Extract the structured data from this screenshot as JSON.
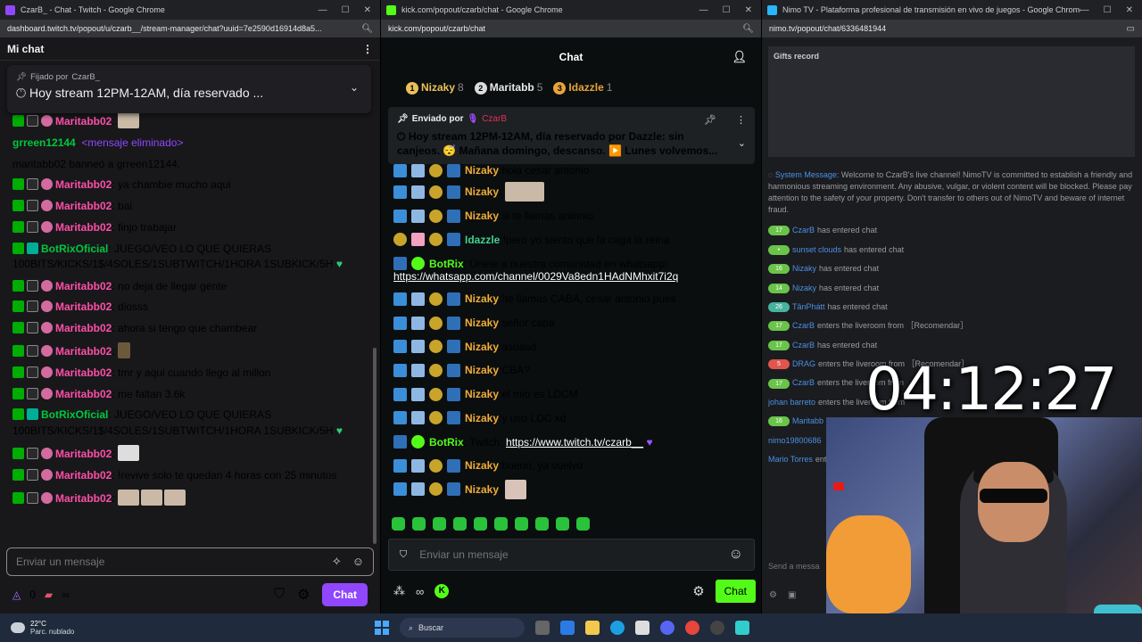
{
  "twitch": {
    "window_title": "CzarB_ - Chat - Twitch - Google Chrome",
    "url": "dashboard.twitch.tv/popout/u/czarb__/stream-manager/chat?uuid=7e2590d16914d8a5...",
    "header": "Mi chat",
    "pinned_by_label": "Fijado por",
    "pinned_by_name": "CzarB_",
    "pinned_message": "Hoy stream 12PM-12AM, día reservado ...",
    "messages": [
      {
        "name": "Maritabb02",
        "text": ""
      },
      {
        "name": "grreen12144",
        "text": "<mensaje eliminado>"
      },
      {
        "name": "",
        "text": "maritabb02 banneó a grreen12144."
      },
      {
        "name": "Maritabb02",
        "text": "ya chambie mucho aqui"
      },
      {
        "name": "Maritabb02",
        "text": "bai"
      },
      {
        "name": "Maritabb02",
        "text": "finjo trabajar"
      },
      {
        "name": "BotRixOficial",
        "text": "JUEGO/VEO LO QUE QUIERAS 100BITS/KICKS/1$/4SOLES/1SUBTWITCH/1HORA 1SUBKICK/5H"
      },
      {
        "name": "Maritabb02",
        "text": "no deja de llegar gente"
      },
      {
        "name": "Maritabb02",
        "text": "diosss"
      },
      {
        "name": "Maritabb02",
        "text": "ahora si tengo que chambear"
      },
      {
        "name": "Maritabb02",
        "text": ""
      },
      {
        "name": "Maritabb02",
        "text": "tmr y aqui cuando llego al millon"
      },
      {
        "name": "Maritabb02",
        "text": "me faltan 3.6k"
      },
      {
        "name": "BotRixOficial",
        "text": "JUEGO/VEO LO QUE QUIERAS 100BITS/KICKS/1$/4SOLES/1SUBTWITCH/1HORA 1SUBKICK/5H"
      },
      {
        "name": "Maritabb02",
        "text": ""
      },
      {
        "name": "Maritabb02",
        "text": "!revive solo te quedan 4 horas con 25 minutos"
      },
      {
        "name": "Maritabb02",
        "text": ""
      }
    ],
    "input_placeholder": "Enviar un mensaje",
    "points": "0",
    "chat_button": "Chat"
  },
  "kick": {
    "window_title": "kick.com/popout/czarb/chat - Google Chrome",
    "url": "kick.com/popout/czarb/chat",
    "header": "Chat",
    "top": [
      {
        "rank": "1",
        "name": "Nizaky",
        "count": "8"
      },
      {
        "rank": "2",
        "name": "Maritabb",
        "count": "5"
      },
      {
        "rank": "3",
        "name": "Idazzle",
        "count": "1"
      }
    ],
    "pinned_sent_by": "Enviado por",
    "pinned_name": "CzarB",
    "pinned_message": "Hoy stream 12PM-12AM, día reservado por Dazzle: sin canjeos. 😴 Mañana domingo, descanso. ▶️ Lunes volvemos...",
    "messages": [
      {
        "name": "Nizaky",
        "text": "hola cesar antonio"
      },
      {
        "name": "Nizaky",
        "text": ""
      },
      {
        "name": "Nizaky",
        "text": "si te llamas antonio"
      },
      {
        "name": "Idazzle",
        "text": "!pero yo siento que la caga la reina"
      },
      {
        "name": "BotRix",
        "text": "Únete a nuestra comunidad en whatsapp:",
        "link": "https://whatsapp.com/channel/0029Va8edn1HAdNMhxit7i2q"
      },
      {
        "name": "Nizaky",
        "text": "!te llamas CABA, cesar antonio pues"
      },
      {
        "name": "Nizaky",
        "text": "señor caba"
      },
      {
        "name": "Nizaky",
        "text": "asdasd"
      },
      {
        "name": "Nizaky",
        "text": "CBA?"
      },
      {
        "name": "Nizaky",
        "text": "el mio es LDCM"
      },
      {
        "name": "Nizaky",
        "text": "y uso LDC xd"
      },
      {
        "name": "BotRix",
        "text": "Twitch:",
        "link": "https://www.twitch.tv/czarb__"
      },
      {
        "name": "Nizaky",
        "text": "bueno, ya vuelvo"
      },
      {
        "name": "Nizaky",
        "text": ""
      }
    ],
    "input_placeholder": "Enviar un mensaje",
    "chat_button": "Chat"
  },
  "nimo": {
    "window_title": "Nimo TV - Plataforma profesional de transmisión en vivo de juegos - Google Chrome",
    "url": "nimo.tv/popout/chat/6336481944",
    "gifts_record": "Gifts record",
    "system_label": "System Message:",
    "system_text": "Welcome to CzarB's live channel! NimoTV is committed to establish a friendly and harmonious streaming environment. Any abusive, vulgar, or violent content will be blocked. Please pay attention to the safety of your property. Don't transfer to others out of NimoTV and beware of internet fraud.",
    "events": [
      {
        "level": "17",
        "name": "CzarB",
        "text": "has entered chat"
      },
      {
        "level": "",
        "name": "sunset clouds",
        "text": "has entered chat"
      },
      {
        "level": "16",
        "name": "Nizaky",
        "text": "has entered chat"
      },
      {
        "level": "14",
        "name": "Nizaky",
        "text": "has entered chat"
      },
      {
        "level": "26",
        "name": "TânPhátt",
        "text": "has entered chat"
      },
      {
        "level": "17",
        "name": "CzarB",
        "text": "enters the liveroom from ［Recomendar］"
      },
      {
        "level": "17",
        "name": "CzarB",
        "text": "has entered chat"
      },
      {
        "level": "5",
        "name": "DRAG",
        "text": "enters the liveroom from ［Recomendar］"
      },
      {
        "level": "17",
        "name": "CzarB",
        "text": "enters the liveroom from"
      },
      {
        "level": "",
        "name": "johan barreto",
        "text": "enters the liveroom from"
      },
      {
        "level": "16",
        "name": "Maritabb",
        "text": ""
      },
      {
        "level": "",
        "name": "nimo19800686",
        "text": ""
      },
      {
        "level": "",
        "name": "Mario Torres",
        "text": "ent"
      }
    ],
    "input_placeholder": "Send a messa"
  },
  "overlay": {
    "timer": "04:12:27"
  },
  "taskbar": {
    "temp": "22°C",
    "weather": "Parc. nublado",
    "search": "Buscar"
  },
  "colors": {
    "twitch_purple": "#9147ff",
    "kick_green": "#53fc18",
    "nimo_blue": "#4a90e2"
  }
}
